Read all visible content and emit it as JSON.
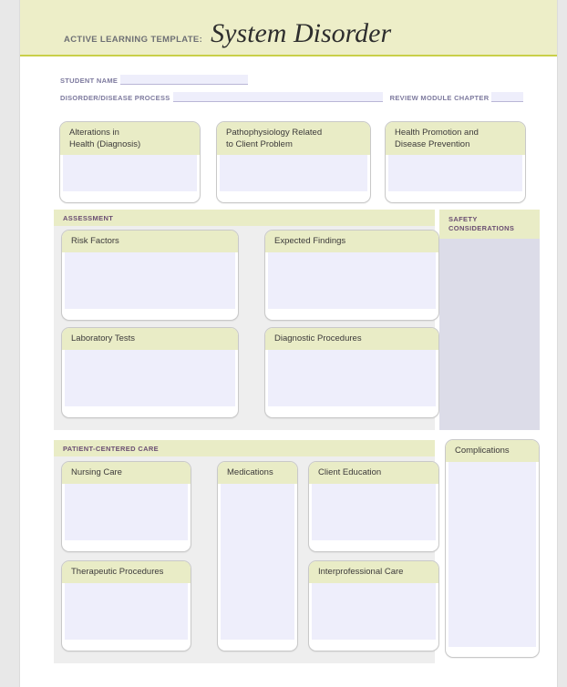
{
  "header": {
    "kicker": "ACTIVE LEARNING TEMPLATE:",
    "title": "System Disorder"
  },
  "id_fields": {
    "student_name_label": "STUDENT NAME",
    "student_name_value": "",
    "disorder_label": "DISORDER/DISEASE PROCESS",
    "disorder_value": "",
    "review_chapter_label": "REVIEW MODULE CHAPTER",
    "review_chapter_value": ""
  },
  "top_boxes": [
    {
      "title": "Alterations in\nHealth (Diagnosis)",
      "value": ""
    },
    {
      "title": "Pathophysiology Related\nto Client Problem",
      "value": ""
    },
    {
      "title": "Health Promotion and\nDisease Prevention",
      "value": ""
    }
  ],
  "assessment": {
    "section_title": "ASSESSMENT",
    "boxes": [
      {
        "title": "Risk Factors",
        "value": ""
      },
      {
        "title": "Expected Findings",
        "value": ""
      },
      {
        "title": "Laboratory Tests",
        "value": ""
      },
      {
        "title": "Diagnostic Procedures",
        "value": ""
      }
    ]
  },
  "patient_centered_care": {
    "section_title": "PATIENT-CENTERED CARE",
    "boxes": [
      {
        "title": "Nursing Care",
        "value": ""
      },
      {
        "title": "Medications",
        "value": ""
      },
      {
        "title": "Client Education",
        "value": ""
      },
      {
        "title": "Therapeutic Procedures",
        "value": ""
      },
      {
        "title": "Interprofessional Care",
        "value": ""
      }
    ]
  },
  "side_boxes": {
    "safety": {
      "title": "SAFETY\nCONSIDERATIONS",
      "value": ""
    },
    "complications": {
      "title": "Complications",
      "value": ""
    }
  },
  "colors": {
    "header_band": "#edeec8",
    "header_rule": "#c9cf49",
    "card_head": "#e9ecc6",
    "card_body": "#eeeefb",
    "section_panel": "#eeeeee",
    "section_title_text": "#6a4e72",
    "id_text": "#7d7a9e",
    "safety_body": "#dcdce8",
    "page_background": "#e8e8e8"
  }
}
